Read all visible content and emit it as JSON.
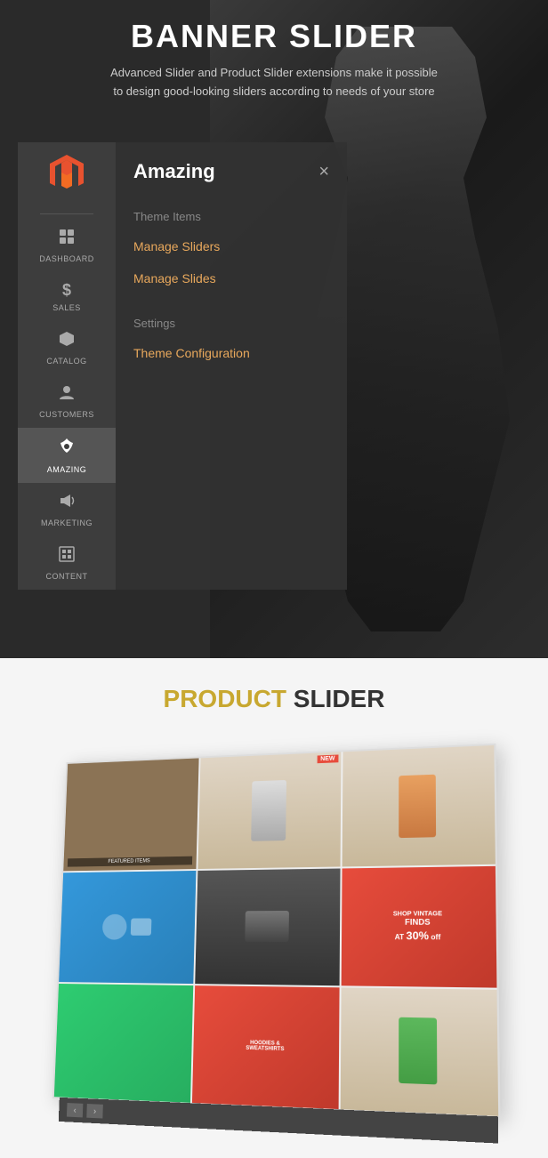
{
  "banner": {
    "title": "BANNER SLIDER",
    "subtitle": "Advanced Slider and Product Slider extensions make it possible to design good-looking sliders according to needs of your store"
  },
  "sidebar": {
    "logo_label": "Magento Logo",
    "items": [
      {
        "id": "dashboard",
        "label": "DASHBOARD",
        "icon": "⊞",
        "active": false
      },
      {
        "id": "sales",
        "label": "SALES",
        "icon": "$",
        "active": false
      },
      {
        "id": "catalog",
        "label": "CATALOG",
        "icon": "⬡",
        "active": false
      },
      {
        "id": "customers",
        "label": "CUSTOMERS",
        "icon": "👤",
        "active": false
      },
      {
        "id": "amazing",
        "label": "AMAZING",
        "icon": "❋",
        "active": true
      },
      {
        "id": "marketing",
        "label": "MARKETING",
        "icon": "📢",
        "active": false
      },
      {
        "id": "content",
        "label": "CONTENT",
        "icon": "▦",
        "active": false
      }
    ]
  },
  "dropdown": {
    "title": "Amazing",
    "close_label": "×",
    "sections": [
      {
        "title": "Theme Items",
        "items": [
          {
            "label": "Manage Sliders"
          },
          {
            "label": "Manage Slides"
          }
        ]
      },
      {
        "title": "Settings",
        "items": [
          {
            "label": "Theme Configuration"
          }
        ]
      }
    ]
  },
  "product_section": {
    "title_highlight": "PRODUCT",
    "title_regular": " SLIDER"
  },
  "icons": {
    "dashboard": "⊞",
    "sales": "$",
    "catalog": "⬡",
    "customers": "👤",
    "amazing": "❋",
    "marketing": "📢",
    "content": "▦",
    "close": "×"
  }
}
